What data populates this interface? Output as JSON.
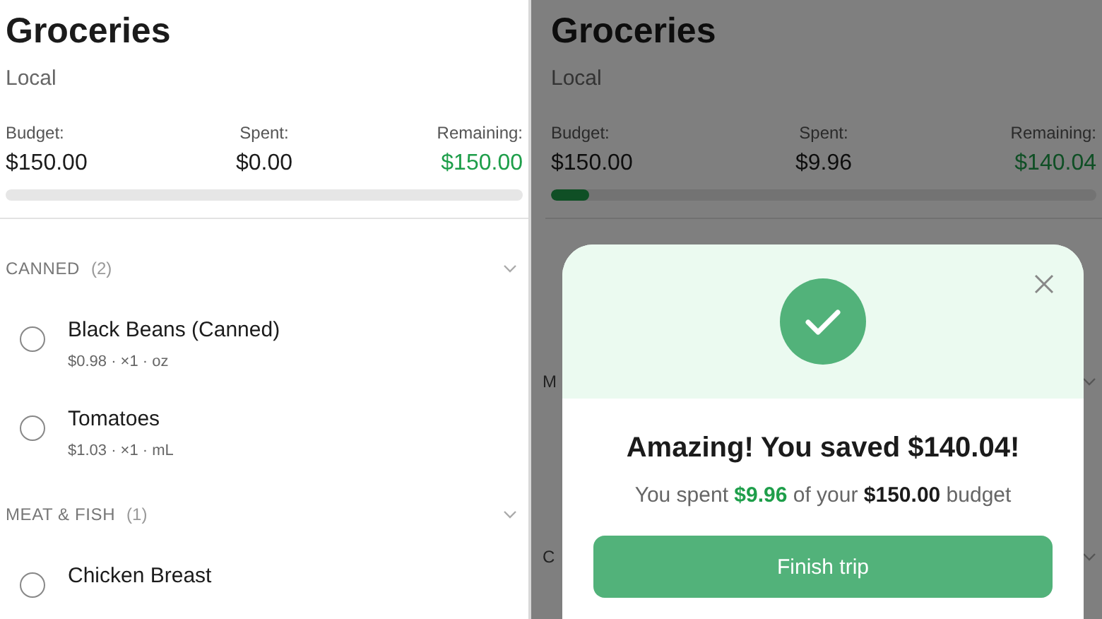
{
  "screens": [
    {
      "title": "Groceries",
      "subtitle": "Local",
      "stats": [
        {
          "label": "Budget:",
          "value": "$150.00",
          "kind": "plain"
        },
        {
          "label": "Spent:",
          "value": "$0.00",
          "kind": "plain"
        },
        {
          "label": "Remaining:",
          "value": "$150.00",
          "kind": "positive"
        }
      ],
      "sections": [
        {
          "name": "CANNED",
          "count": "(2)",
          "expanded": true,
          "items": [
            {
              "name": "Black Beans (Canned)",
              "meta": "$0.98 · ×1 · oz",
              "checked": false
            },
            {
              "name": "Tomatoes",
              "meta": "$1.03 · ×1 · mL",
              "checked": false
            }
          ]
        },
        {
          "name": "MEAT & FISH",
          "count": "(1)",
          "expanded": true,
          "items": [
            {
              "name": "Chicken Breast",
              "checked": false
            }
          ]
        }
      ]
    },
    {
      "title": "Groceries",
      "subtitle": "Local",
      "stats": [
        {
          "label": "Budget:",
          "value": "$150.00",
          "kind": "plain"
        },
        {
          "label": "Spent:",
          "value": "$9.96",
          "kind": "plain"
        },
        {
          "label": "Remaining:",
          "value": "$140.04",
          "kind": "positive"
        }
      ],
      "progress": {
        "level": 0.07
      },
      "hidden_sections": [
        {
          "name": "M",
          "expanded": true
        },
        {
          "name": "C",
          "expanded": true
        }
      ],
      "dialog": {
        "title": "Amazing! You saved $140.04!",
        "message": [
          {
            "text": "You spent ",
            "kind": "plain"
          },
          {
            "text": "$9.96",
            "kind": "spent"
          },
          {
            "text": " of your ",
            "kind": "plain"
          },
          {
            "text": "$150.00",
            "kind": "budget"
          },
          {
            "text": " budget",
            "kind": "plain"
          }
        ],
        "button": "Finish trip"
      }
    }
  ]
}
